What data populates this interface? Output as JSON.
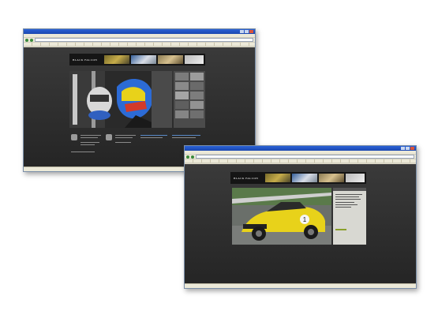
{
  "site": {
    "brand": "BLACK FALCON"
  },
  "windows": [
    {
      "id": "front-window",
      "content": "homepage-with-driver-photo"
    },
    {
      "id": "back-window",
      "content": "gallery-page-with-race-car"
    }
  ],
  "colors": {
    "titlebar": "#1f55c8",
    "chrome": "#ece9d8",
    "page_bg": "#2f2f2f",
    "car_yellow": "#e8d21a"
  }
}
